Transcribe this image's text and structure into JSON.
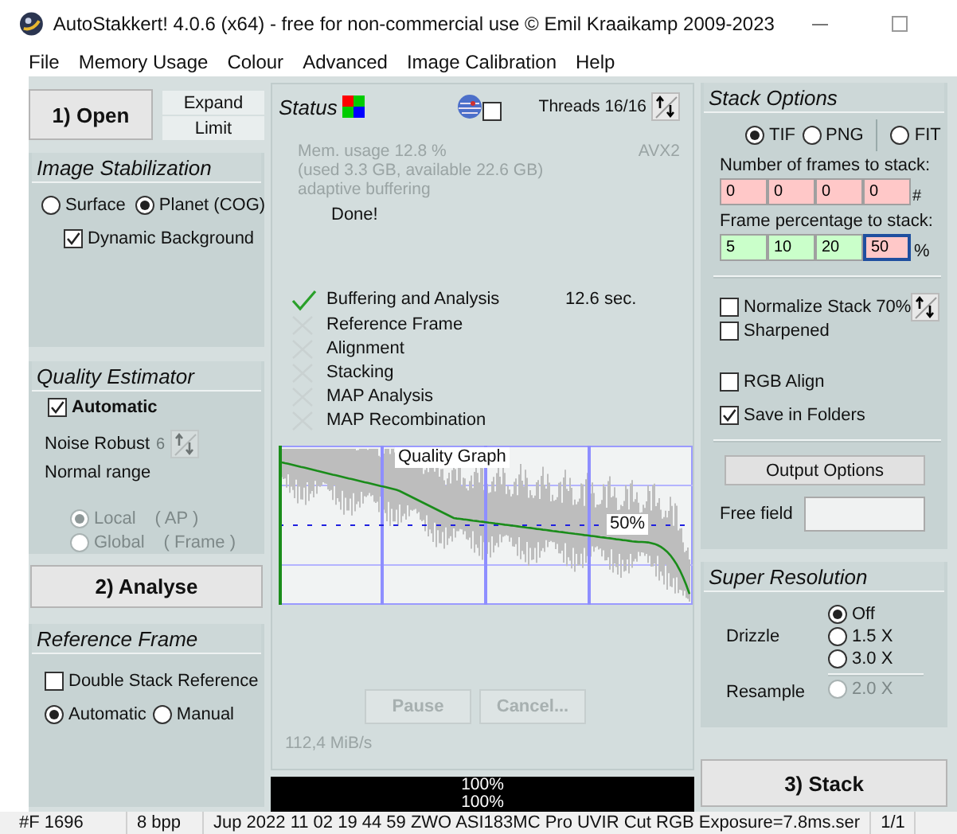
{
  "window": {
    "title": "AutoStakkert! 4.0.6 (x64) - free for non-commercial use © Emil Kraaikamp 2009-2023"
  },
  "menu": [
    "File",
    "Memory Usage",
    "Colour",
    "Advanced",
    "Image Calibration",
    "Help"
  ],
  "left": {
    "open_button": "1) Open",
    "expand_button": "Expand",
    "limit_button": "Limit",
    "image_stabilization": {
      "title": "Image Stabilization",
      "modes": [
        {
          "label": "Surface",
          "selected": false
        },
        {
          "label": "Planet (COG)",
          "selected": true
        }
      ],
      "dynamic_background": {
        "label": "Dynamic Background",
        "checked": true
      }
    },
    "quality_estimator": {
      "title": "Quality Estimator",
      "automatic": {
        "label": "Automatic",
        "checked": true
      },
      "noise_robust": {
        "label": "Noise Robust",
        "value": "6"
      },
      "range": "Normal range",
      "scopes": [
        {
          "label": "Local",
          "detail": "( AP )",
          "selected": true,
          "disabled": true
        },
        {
          "label": "Global",
          "detail": "( Frame )",
          "selected": false,
          "disabled": true
        }
      ]
    },
    "analyse_button": "2) Analyse",
    "reference_frame": {
      "title": "Reference Frame",
      "double_stack": {
        "label": "Double Stack Reference",
        "checked": false
      },
      "modes": [
        {
          "label": "Automatic",
          "selected": true
        },
        {
          "label": "Manual",
          "selected": false
        }
      ]
    }
  },
  "status": {
    "title": "Status",
    "network": {
      "checked": false
    },
    "threads": "Threads 16/16",
    "memory": [
      "Mem. usage 12.8 %",
      "(used 3.3 GB, available 22.6 GB)",
      "adaptive buffering"
    ],
    "cpu": "AVX2",
    "message": "Done!",
    "steps": [
      {
        "label": "Buffering and Analysis",
        "done": true,
        "time": "12.6 sec."
      },
      {
        "label": "Reference Frame",
        "done": false
      },
      {
        "label": "Alignment",
        "done": false
      },
      {
        "label": "Stacking",
        "done": false
      },
      {
        "label": "MAP Analysis",
        "done": false
      },
      {
        "label": "MAP Recombination",
        "done": false
      }
    ],
    "graph": {
      "title": "Quality Graph",
      "marker": "50%"
    },
    "pause_button": {
      "label": "Pause",
      "disabled": true
    },
    "cancel_button": {
      "label": "Cancel...",
      "disabled": true
    },
    "speed": "112,4 MiB/s",
    "progress": [
      {
        "label": "100%",
        "level": 1
      },
      {
        "label": "100%",
        "level": 1
      }
    ]
  },
  "stack_options": {
    "title": "Stack Options",
    "formats": [
      {
        "label": "TIF",
        "selected": true
      },
      {
        "label": "PNG",
        "selected": false
      },
      {
        "label": "FIT",
        "selected": false
      }
    ],
    "frames_label": "Number of frames to stack:",
    "frames": [
      "0",
      "0",
      "0",
      "0"
    ],
    "frames_unit": "#",
    "percent_label": "Frame percentage to stack:",
    "percentages": [
      {
        "value": "5",
        "focused": false
      },
      {
        "value": "10",
        "focused": false
      },
      {
        "value": "20",
        "focused": false
      },
      {
        "value": "50",
        "focused": true
      }
    ],
    "percent_unit": "%",
    "options": [
      {
        "label": "Normalize Stack 70%",
        "checked": false
      },
      {
        "label": "Sharpened",
        "checked": false
      },
      {
        "label": "RGB Align",
        "checked": false
      },
      {
        "label": "Save in Folders",
        "checked": true
      }
    ],
    "output_button": "Output Options",
    "free_field": {
      "label": "Free field"
    }
  },
  "super_resolution": {
    "title": "Super Resolution",
    "drizzle_label": "Drizzle",
    "drizzle": [
      {
        "label": "Off",
        "selected": true
      },
      {
        "label": "1.5 X",
        "selected": false
      },
      {
        "label": "3.0 X",
        "selected": false
      }
    ],
    "resample_label": "Resample",
    "resample": [
      {
        "label": "2.0 X",
        "selected": false,
        "disabled": true
      }
    ]
  },
  "stack_button": "3) Stack",
  "status_bar": [
    "#F 1696",
    "8 bpp",
    "Jup 2022 11 02 19 44 59 ZWO ASI183MC Pro UVIR Cut RGB Exposure=7.8ms.ser",
    "1/1"
  ]
}
